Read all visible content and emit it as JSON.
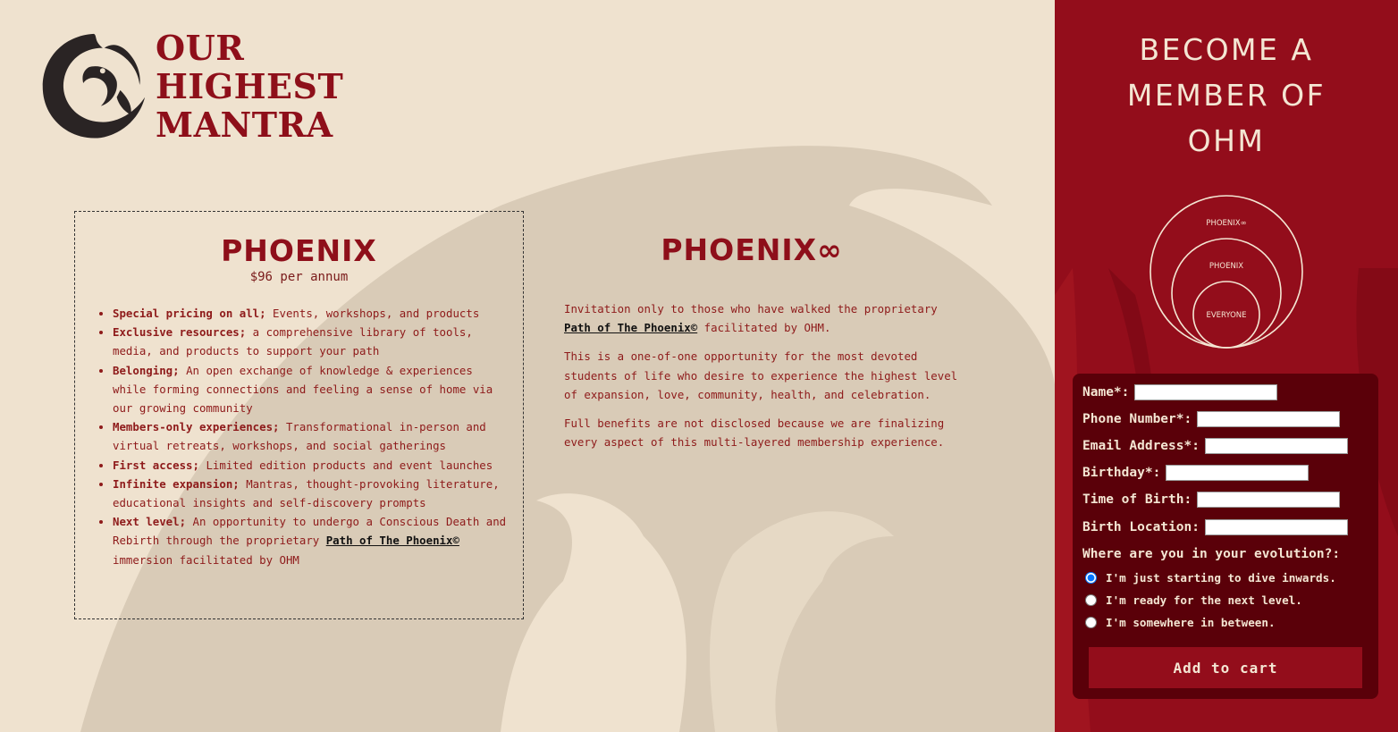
{
  "logo": {
    "line1": "OUR",
    "line2": "HIGHEST",
    "line3": "MANTRA"
  },
  "phoenix": {
    "title": "PHOENIX",
    "price": "$96 per annum",
    "benefits": [
      {
        "bold": "Special pricing on all;",
        "text": " Events, workshops, and products"
      },
      {
        "bold": "Exclusive resources;",
        "text": " a comprehensive library of tools, media, and products to support your path"
      },
      {
        "bold": "Belonging;",
        "text": " An open exchange of knowledge & experiences while forming connections and feeling a sense of home via our growing community"
      },
      {
        "bold": "Members-only experiences;",
        "text": " Transformational in-person and virtual retreats, workshops, and social gatherings"
      },
      {
        "bold": "First access;",
        "text": " Limited edition products and event launches"
      },
      {
        "bold": "Infinite expansion;",
        "text": " Mantras, thought-provoking literature, educational insights and self-discovery prompts"
      },
      {
        "bold": "Next level;",
        "text": " An opportunity to undergo a Conscious Death and Rebirth through the proprietary ",
        "link": "Path of The Phoenix©",
        "after": " immersion facilitated by OHM"
      }
    ]
  },
  "phoenix_inf": {
    "title": "PHOENIX∞",
    "p1_before": "Invitation only to those who have walked the proprietary ",
    "p1_link": "Path of The Phoenix©",
    "p1_after": " facilitated by OHM.",
    "p2": "This is a one-of-one opportunity for the most devoted students of life who desire to experience the highest level of expansion, love, community, health, and celebration.",
    "p3": "Full benefits are not disclosed because we are finalizing every aspect of this multi-layered membership experience."
  },
  "signup": {
    "heading_line1": "BECOME A",
    "heading_line2": "MEMBER OF",
    "heading_line3": "OHM",
    "diagram": {
      "outer": "PHOENIX∞",
      "middle": "PHOENIX",
      "inner": "EVERYONE"
    },
    "fields": {
      "name": "Name*:",
      "phone": "Phone Number*:",
      "email": "Email Address*:",
      "birthday": "Birthday*:",
      "time": "Time of Birth:",
      "location": "Birth Location:"
    },
    "evolution_label": "Where are you in your evolution?:",
    "options": [
      "I'm just starting to dive inwards.",
      "I'm ready for the next level.",
      "I'm somewhere in between."
    ],
    "selected_option": 0,
    "submit": "Add to cart"
  },
  "colors": {
    "background": "#efe2cf",
    "accent": "#8e0f1a",
    "panel": "#930d1b",
    "form": "#5a0009",
    "panel_text": "#f4e6d3"
  }
}
